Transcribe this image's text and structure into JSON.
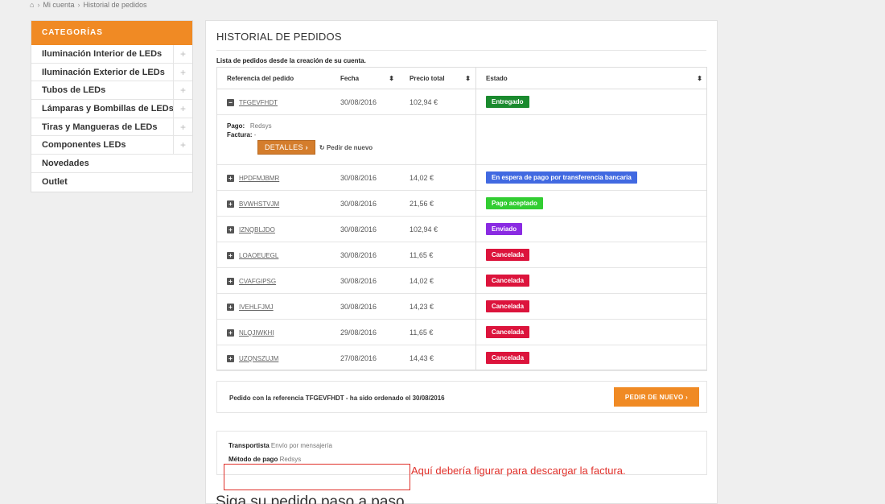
{
  "breadcrumb": {
    "home_icon": "home-icon",
    "items": [
      "Mi cuenta",
      "Historial de pedidos"
    ]
  },
  "sidebar": {
    "title": "CATEGORÍAS",
    "items": [
      {
        "label": "Iluminación Interior de LEDs",
        "expandable": true
      },
      {
        "label": "Iluminación Exterior de LEDs",
        "expandable": true
      },
      {
        "label": "Tubos de LEDs",
        "expandable": true
      },
      {
        "label": "Lámparas y Bombillas de LEDs",
        "expandable": true
      },
      {
        "label": "Tiras y Mangueras de LEDs",
        "expandable": true
      },
      {
        "label": "Componentes LEDs",
        "expandable": true
      },
      {
        "label": "Novedades",
        "expandable": false
      },
      {
        "label": "Outlet",
        "expandable": false
      }
    ]
  },
  "main": {
    "title": "HISTORIAL DE PEDIDOS",
    "subtitle": "Lista de pedidos desde la creación de su cuenta.",
    "columns": [
      "Referencia del pedido",
      "Fecha",
      "Precio total",
      "Estado"
    ],
    "orders": [
      {
        "ref": "TFGEVFHDT",
        "date": "30/08/2016",
        "price": "102,94 €",
        "status": "Entregado",
        "color": "#1a8a2e",
        "expanded": true
      },
      {
        "ref": "HPDFMJBMR",
        "date": "30/08/2016",
        "price": "14,02 €",
        "status": "En espera de pago por transferencia bancaria",
        "color": "#4169e1"
      },
      {
        "ref": "BVWHSTVJM",
        "date": "30/08/2016",
        "price": "21,56 €",
        "status": "Pago aceptado",
        "color": "#32cd32"
      },
      {
        "ref": "IZNQBLJDO",
        "date": "30/08/2016",
        "price": "102,94 €",
        "status": "Enviado",
        "color": "#8a2be2"
      },
      {
        "ref": "LOAOEUEGL",
        "date": "30/08/2016",
        "price": "11,65 €",
        "status": "Cancelada",
        "color": "#dc143c"
      },
      {
        "ref": "CVAFGIPSG",
        "date": "30/08/2016",
        "price": "14,02 €",
        "status": "Cancelada",
        "color": "#dc143c"
      },
      {
        "ref": "IVEHLFJMJ",
        "date": "30/08/2016",
        "price": "14,23 €",
        "status": "Cancelada",
        "color": "#dc143c"
      },
      {
        "ref": "NLQJIWKHI",
        "date": "29/08/2016",
        "price": "11,65 €",
        "status": "Cancelada",
        "color": "#dc143c"
      },
      {
        "ref": "UZQNSZUJM",
        "date": "27/08/2016",
        "price": "14,43 €",
        "status": "Cancelada",
        "color": "#dc143c"
      }
    ],
    "detail": {
      "pago_label": "Pago:",
      "pago_value": "Redsys",
      "factura_label": "Factura:",
      "factura_value": "-",
      "detalles_button": "DETALLES",
      "reorder_link": "Pedir de nuevo"
    },
    "reorder_box": {
      "text": "Pedido con la referencia TFGEVFHDT - ha sido ordenado el 30/08/2016",
      "button": "PEDIR DE NUEVO"
    },
    "shipping": {
      "carrier_label": "Transportista",
      "carrier_value": "Envío por mensajería",
      "payment_label": "Método de pago",
      "payment_value": "Redsys"
    },
    "annotation": "Aquí debería figurar para descargar la factura.",
    "step_title": "Siga su pedido paso a paso"
  }
}
